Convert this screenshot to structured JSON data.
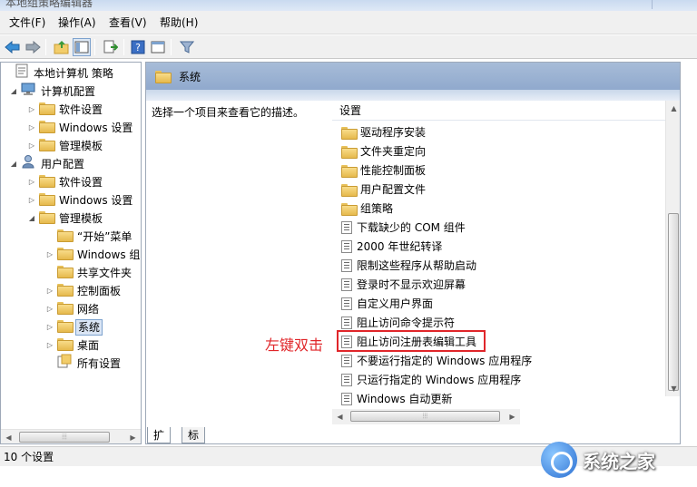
{
  "window": {
    "title": "本地组策略编辑器"
  },
  "menu": [
    "文件(F)",
    "操作(A)",
    "查看(V)",
    "帮助(H)"
  ],
  "tree": {
    "root": "本地计算机 策略",
    "computer": "计算机配置",
    "c_software": "软件设置",
    "c_windows": "Windows 设置",
    "c_admin": "管理模板",
    "user": "用户配置",
    "u_software": "软件设置",
    "u_windows": "Windows 设置",
    "u_admin": "管理模板",
    "start_menu": "“开始”菜单",
    "windows_comp": "Windows 组",
    "shared": "共享文件夹",
    "control_panel": "控制面板",
    "network": "网络",
    "system": "系统",
    "desktop": "桌面",
    "all_settings": "所有设置"
  },
  "right": {
    "header": "系统",
    "description": "选择一个项目来查看它的描述。",
    "column": "设置",
    "rows": [
      {
        "type": "folder",
        "label": "驱动程序安装"
      },
      {
        "type": "folder",
        "label": "文件夹重定向"
      },
      {
        "type": "folder",
        "label": "性能控制面板"
      },
      {
        "type": "folder",
        "label": "用户配置文件"
      },
      {
        "type": "folder",
        "label": "组策略"
      },
      {
        "type": "setting",
        "label": "下载缺少的 COM 组件"
      },
      {
        "type": "setting",
        "label": "2000 年世纪转译"
      },
      {
        "type": "setting",
        "label": "限制这些程序从帮助启动"
      },
      {
        "type": "setting",
        "label": "登录时不显示欢迎屏幕"
      },
      {
        "type": "setting",
        "label": "自定义用户界面"
      },
      {
        "type": "setting",
        "label": "阻止访问命令提示符"
      },
      {
        "type": "setting",
        "label": "阻止访问注册表编辑工具"
      },
      {
        "type": "setting",
        "label": "不要运行指定的 Windows 应用程序"
      },
      {
        "type": "setting",
        "label": "只运行指定的 Windows 应用程序"
      },
      {
        "type": "setting",
        "label": "Windows 自动更新"
      }
    ]
  },
  "tabs": {
    "extended": "扩展",
    "standard": "标准"
  },
  "status": "10 个设置",
  "annotation": "左键双击",
  "watermark": "系统之家",
  "colors": {
    "highlight": "#e0262a",
    "header": "#a7bcd8",
    "selection": "#dae5f4"
  }
}
